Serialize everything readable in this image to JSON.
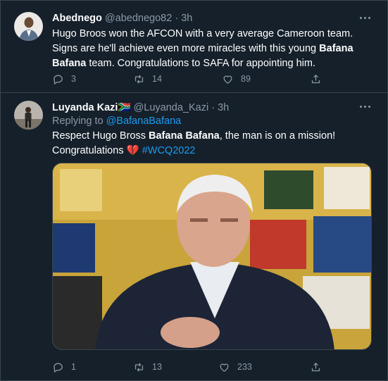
{
  "tweet1": {
    "name": "Abednego",
    "handle": "@abednego82",
    "time": "3h",
    "text_pre": "Hugo Broos won the AFCON with a very average Cameroon team. Signs are he'll achieve even more miracles with this young ",
    "text_bold": "Bafana Bafana",
    "text_post": " team. Congratulations to SAFA for appointing him.",
    "replies": "3",
    "retweets": "14",
    "likes": "89"
  },
  "tweet2": {
    "name": "Luyanda Kazi",
    "flag": "🇿🇦",
    "handle": "@Luyanda_Kazi",
    "time": "3h",
    "replying_prefix": "Replying to ",
    "replying_to": "@BafanaBafana",
    "text_pre": "Respect Hugo Bross ",
    "text_bold": "Bafana Bafana",
    "text_post": ", the man is on a mission!",
    "line2": "Congratulations ",
    "emoji": "💔",
    "hashtag": "#WCQ2022",
    "replies": "1",
    "retweets": "13",
    "likes": "233"
  },
  "colors": {
    "background": "#15202b",
    "text": "#ffffff",
    "secondary": "#8b98a5",
    "accent": "#1d9bf0",
    "border": "#38444d"
  },
  "icons": [
    "more-icon",
    "reply-icon",
    "retweet-icon",
    "like-icon",
    "share-icon"
  ]
}
